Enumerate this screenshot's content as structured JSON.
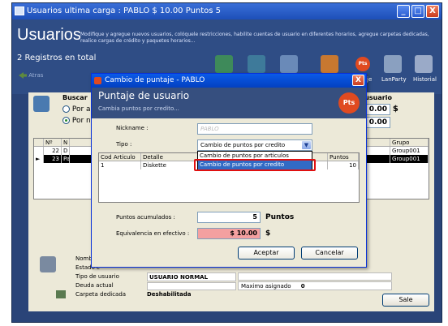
{
  "window": {
    "title": "Usuarios ultima carga : PABLO $ 10.00 Puntos 5",
    "min": "_",
    "max": "□",
    "close": "X"
  },
  "header": {
    "big_title": "Usuarios",
    "description": "Modifique y agregue nuevos usuarios, colóquele restricciones, habilite cuentas de usuario en diferentes horarios, agregue carpetas dedicadas, realice cargas de crédito y paquetes horarios...",
    "records": "2 Registros en total",
    "nav_back": "Atras",
    "toolbar_pts": "Pts",
    "toolbar_labels": [
      "je",
      "LanParty",
      "Historial"
    ]
  },
  "search": {
    "label": "Buscar",
    "radio1": "Por a",
    "radio2": "Por n"
  },
  "right_panel": {
    "title": "e usuario",
    "value1": "0.00",
    "currency": "$",
    "value2": "0.00"
  },
  "grid": {
    "headers": [
      "Nº",
      "N",
      "",
      "Grupo"
    ],
    "rows": [
      {
        "num": "22",
        "n": "D",
        "grupo": "Group001"
      },
      {
        "num": "23",
        "n": "Pa",
        "grupo": "Group001"
      }
    ]
  },
  "footer": {
    "nombre_label": "Nombre",
    "estado_label": "Estado c",
    "tipo_label": "Tipo de usuario",
    "tipo_value": "USUARIO NORMAL",
    "deuda_label": "Deuda actual",
    "carpeta_label": "Carpeta dedicada",
    "carpeta_value": "Deshabilitada",
    "maximo_label": "Maximo asignado",
    "maximo_value": "0",
    "sale_button": "Sale"
  },
  "dialog": {
    "title": "Cambio de puntaje - PABLO",
    "header_title": "Puntaje de usuario",
    "header_sub": "Cambia puntos por credito...",
    "pts_badge": "Pts",
    "nickname_label": "Nickname :",
    "nickname_placeholder": "PABLO",
    "tipo_label": "Tipo :",
    "tipo_value": "Cambio de puntos por credito",
    "tipo_options": [
      "Cambio de puntos por articulos",
      "Cambio de puntos por credito"
    ],
    "grid_headers": [
      "Cod Articulo",
      "Detalle",
      "Puntos"
    ],
    "grid_row": {
      "cod": "1",
      "detalle": "Diskette",
      "puntos": "10"
    },
    "acumulados_label": "Puntos acumulados :",
    "acumulados_value": "5",
    "acumulados_unit": "Puntos",
    "equivalencia_label": "Equivalencia en efectivo :",
    "equivalencia_value": "$ 10.00",
    "equivalencia_unit": "$",
    "accept_button": "Aceptar",
    "cancel_button": "Cancelar"
  },
  "colors": {
    "accent": "#316ac5",
    "highlight_red": "#e01010",
    "equivalencia_bg": "#f4a0a0"
  }
}
